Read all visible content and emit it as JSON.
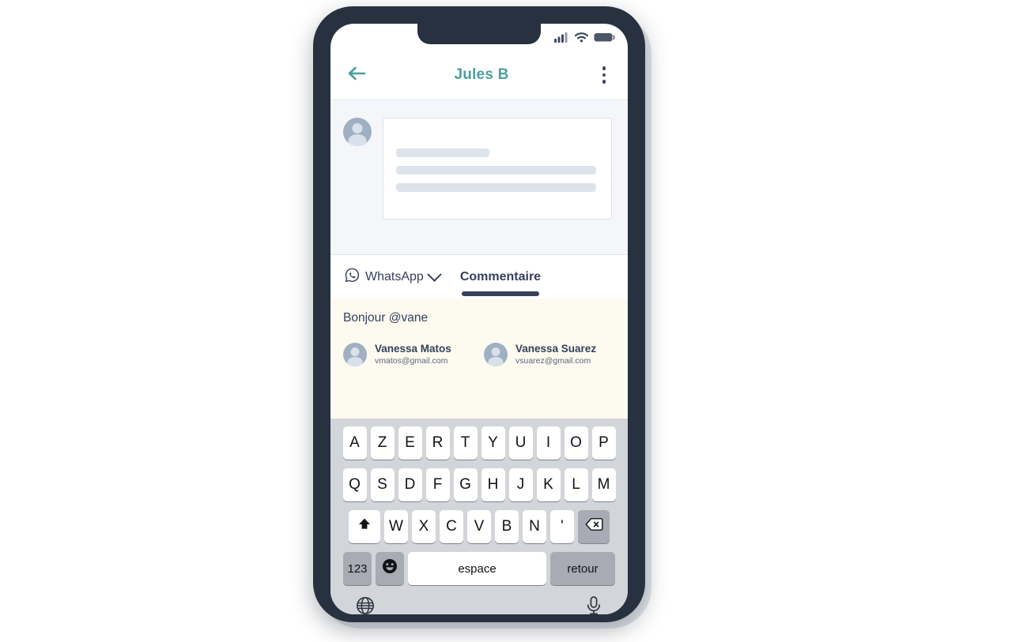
{
  "device": {
    "frame_color": "#27313f",
    "screen_bg": "#ffffff",
    "status_bar": {
      "signal_icon": "signal-bars-icon",
      "wifi_icon": "wifi-icon",
      "battery_icon": "battery-icon"
    }
  },
  "header": {
    "back_icon": "arrow-left-icon",
    "title": "Jules B",
    "title_color": "#4a9f9d",
    "menu_icon": "kebab-menu-icon"
  },
  "message_area": {
    "avatar_icon": "user-avatar-icon",
    "placeholder_lines": 3
  },
  "tabs": [
    {
      "id": "whatsapp",
      "label": "WhatsApp",
      "icon": "whatsapp-icon",
      "has_chevron": true,
      "active": false
    },
    {
      "id": "commentaire",
      "label": "Commentaire",
      "active": true
    }
  ],
  "composer": {
    "draft_text": "Bonjour @vane",
    "panel_color": "#fdfaf0",
    "mentions": [
      {
        "name": "Vanessa Matos",
        "email": "vmatos@gmail.com",
        "avatar_icon": "user-avatar-icon"
      },
      {
        "name": "Vanessa Suarez",
        "email": "vsuarez@gmail.com",
        "avatar_icon": "user-avatar-icon"
      }
    ]
  },
  "keyboard": {
    "layout": "AZERTY",
    "row1": [
      "A",
      "Z",
      "E",
      "R",
      "T",
      "Y",
      "U",
      "I",
      "O",
      "P"
    ],
    "row2": [
      "Q",
      "S",
      "D",
      "F",
      "G",
      "H",
      "J",
      "K",
      "L",
      "M"
    ],
    "row3_letters": [
      "W",
      "X",
      "C",
      "V",
      "B",
      "N",
      "'"
    ],
    "shift_icon": "shift-arrow-icon",
    "backspace_icon": "backspace-icon",
    "numeric_label": "123",
    "emoji_icon": "emoji-smiley-icon",
    "space_label": "espace",
    "return_label": "retour",
    "globe_icon": "globe-icon",
    "mic_icon": "microphone-icon"
  }
}
